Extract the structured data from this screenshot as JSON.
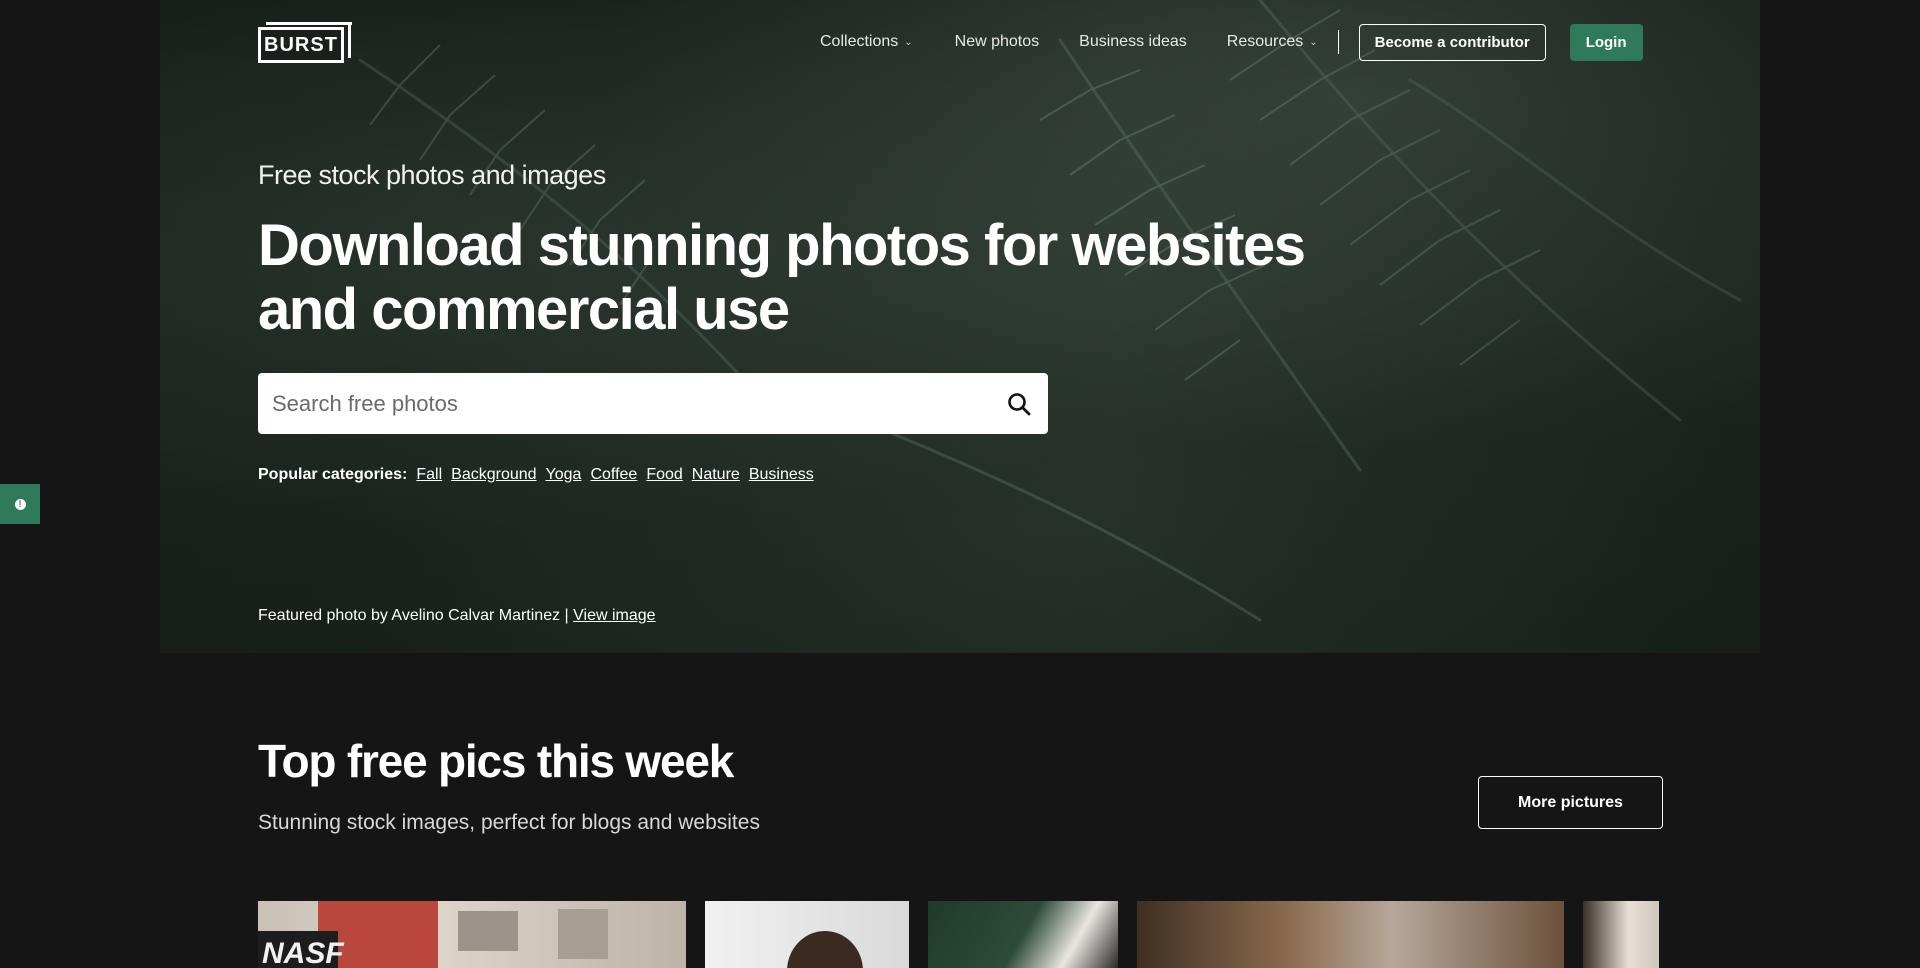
{
  "nav": {
    "logo_text": "BURST",
    "items": [
      {
        "label": "Collections",
        "has_dropdown": true
      },
      {
        "label": "New photos",
        "has_dropdown": false
      },
      {
        "label": "Business ideas",
        "has_dropdown": false
      },
      {
        "label": "Resources",
        "has_dropdown": true
      }
    ],
    "contributor_label": "Become a contributor",
    "login_label": "Login"
  },
  "hero": {
    "eyebrow": "Free stock photos and images",
    "headline": "Download stunning photos for websites and commercial use",
    "search_placeholder": "Search free photos",
    "popular_label": "Popular categories:",
    "categories": [
      "Fall",
      "Background",
      "Yoga",
      "Coffee",
      "Food",
      "Nature",
      "Business"
    ],
    "featured_text": "Featured photo by Avelino Calvar Martinez |",
    "featured_link": "View image"
  },
  "section": {
    "title": "Top free pics this week",
    "subtitle": "Stunning stock images, perfect for blogs and websites",
    "more_label": "More pictures"
  },
  "colors": {
    "background": "#151515",
    "accent_green": "#2f7a5a",
    "hero_tint": "#26312a"
  },
  "icons": {
    "search": "search-icon",
    "chevron": "chevron-down-icon",
    "feedback": "info-icon"
  }
}
